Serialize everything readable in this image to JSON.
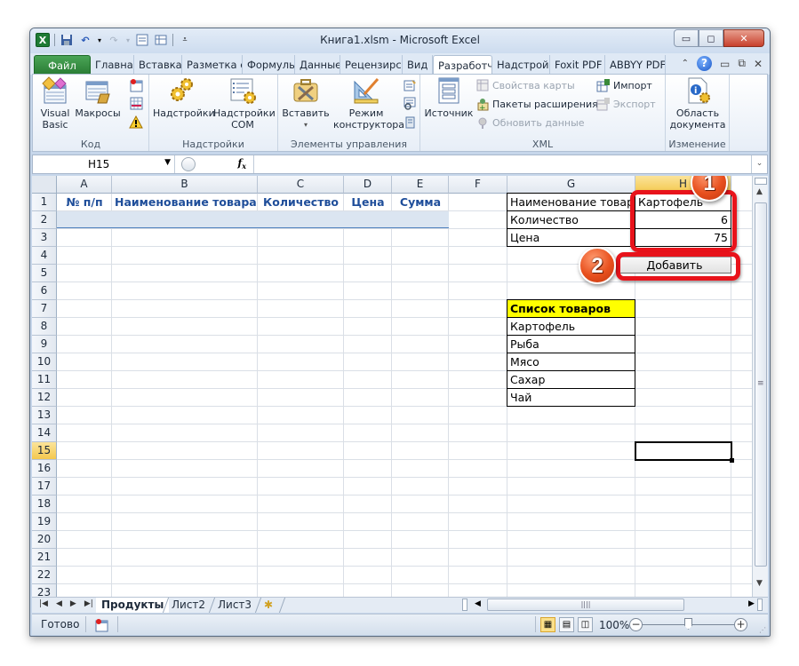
{
  "window": {
    "title": "Книга1.xlsm - Microsoft Excel",
    "controls": {
      "minimize": "minimize",
      "maximize": "restore",
      "close": "close"
    }
  },
  "qat": {
    "icons": [
      "excel-logo-icon",
      "save-icon",
      "undo-icon",
      "redo-icon",
      "form-icon",
      "table-icon",
      "customize-qat-icon"
    ]
  },
  "ribbon_tabs": [
    {
      "label": "Файл"
    },
    {
      "label": "Главная"
    },
    {
      "label": "Вставка"
    },
    {
      "label": "Разметка с"
    },
    {
      "label": "Формулы"
    },
    {
      "label": "Данные"
    },
    {
      "label": "Рецензирс"
    },
    {
      "label": "Вид"
    },
    {
      "label": "Разработч",
      "active": true
    },
    {
      "label": "Надстройк"
    },
    {
      "label": "Foxit PDF"
    },
    {
      "label": "ABBYY PDF"
    }
  ],
  "ribbon": {
    "groups": {
      "code": {
        "label": "Код",
        "visual_basic": "Visual Basic",
        "visual_basic_l1": "Visual",
        "visual_basic_l2": "Basic",
        "macros": "Макросы"
      },
      "addins": {
        "label": "Надстройки",
        "addins": "Надстройки",
        "com_addins_l1": "Надстройки",
        "com_addins_l2": "COM"
      },
      "controls": {
        "label": "Элементы управления",
        "insert": "Вставить",
        "design_mode_l1": "Режим",
        "design_mode_l2": "конструктора"
      },
      "xml": {
        "label": "XML",
        "source": "Источник",
        "map_properties": "Свойства карты",
        "expansion_packs": "Пакеты расширения",
        "refresh_data": "Обновить данные",
        "import": "Импорт",
        "export": "Экспорт"
      },
      "modify": {
        "label": "Изменение",
        "doc_panel_l1": "Область",
        "doc_panel_l2": "документа"
      }
    }
  },
  "formula_bar": {
    "name_box": "H15",
    "fx": "fx",
    "formula": ""
  },
  "columns": [
    "A",
    "B",
    "C",
    "D",
    "E",
    "F",
    "G",
    "H"
  ],
  "rows": [
    "1",
    "2",
    "3",
    "4",
    "5",
    "6",
    "7",
    "8",
    "9",
    "10",
    "11",
    "12",
    "13",
    "14",
    "15",
    "16",
    "17",
    "18",
    "19",
    "20",
    "21",
    "22",
    "23"
  ],
  "selected_cell": "H15",
  "table_headers": [
    "№ п/п",
    "Наименование товара",
    "Количество",
    "Цена",
    "Сумма"
  ],
  "input_form": [
    {
      "label": "Наименование товара",
      "value": "Картофель"
    },
    {
      "label": "Количество",
      "value": "6"
    },
    {
      "label": "Цена",
      "value": "75"
    }
  ],
  "add_button": {
    "label": "Добавить"
  },
  "product_list": {
    "header": "Список товаров",
    "items": [
      "Картофель",
      "Рыба",
      "Мясо",
      "Сахар",
      "Чай"
    ]
  },
  "callouts": [
    {
      "number": "1",
      "color": "#e8131b"
    },
    {
      "number": "2",
      "color": "#e8131b"
    }
  ],
  "sheet_tabs": [
    {
      "label": "Продукты",
      "active": true
    },
    {
      "label": "Лист2"
    },
    {
      "label": "Лист3"
    }
  ],
  "status_bar": {
    "ready": "Готово",
    "zoom": "100%"
  },
  "colors": {
    "table_header_text": "#1f4e9a",
    "list_header_bg": "#ffff00",
    "callout_red": "#e8131b",
    "file_tab_green": "#2b7e36"
  }
}
